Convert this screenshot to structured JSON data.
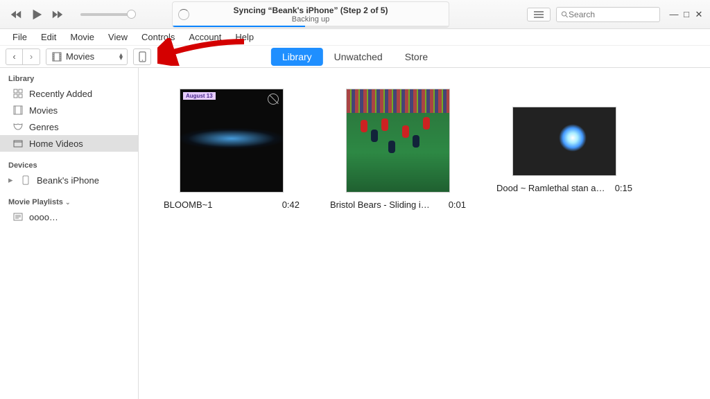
{
  "status": {
    "title": "Syncing “Beank's iPhone” (Step 2 of 5)",
    "subtitle": "Backing up"
  },
  "search": {
    "placeholder": "Search"
  },
  "menus": [
    "File",
    "Edit",
    "Movie",
    "View",
    "Controls",
    "Account",
    "Help"
  ],
  "category_select": {
    "label": "Movies"
  },
  "tabs": {
    "library": "Library",
    "unwatched": "Unwatched",
    "store": "Store"
  },
  "sidebar": {
    "library_head": "Library",
    "library_items": [
      {
        "icon": "grid",
        "label": "Recently Added"
      },
      {
        "icon": "film",
        "label": "Movies"
      },
      {
        "icon": "masks",
        "label": "Genres"
      },
      {
        "icon": "home",
        "label": "Home Videos"
      }
    ],
    "devices_head": "Devices",
    "devices": [
      {
        "label": "Beank's iPhone"
      }
    ],
    "playlists_head": "Movie Playlists",
    "playlists": [
      {
        "label": "oooo…"
      }
    ]
  },
  "videos": [
    {
      "title": "BLOOMB~1",
      "duration": "0:42",
      "badge": "August 13"
    },
    {
      "title": "Bristol Bears - Sliding i…",
      "duration": "0:01"
    },
    {
      "title": "Dood ~ Ramlethal stan acco…",
      "duration": "0:15"
    }
  ]
}
